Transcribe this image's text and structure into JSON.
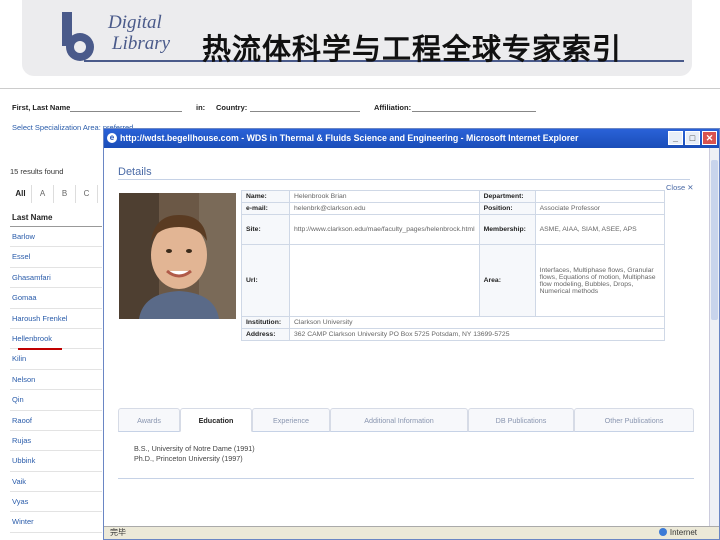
{
  "slide": {
    "logo_line1": "Digital",
    "logo_line2": "Library",
    "title": "热流体科学与工程全球专家索引"
  },
  "search_page": {
    "labels": {
      "name": "First, Last Name",
      "in": "in:",
      "country": "Country:",
      "affiliation": "Affiliation:"
    },
    "specialization": "Select Specialization Area:     preferred",
    "results_found": "15 results found",
    "alpha_tabs": [
      "All",
      "A",
      "B",
      "C"
    ],
    "list_header": "Last Name",
    "names": [
      "Barlow",
      "Essel",
      "Ghasamfari",
      "Gomaa",
      "Haroush Frenkel",
      "Hellenbrook",
      "Kilin",
      "Nelson",
      "Qin",
      "Raoof",
      "Rujas",
      "Ubbink",
      "Vaik",
      "Vyas",
      "Winter"
    ],
    "selected_name": "Hellenbrook"
  },
  "ie_window": {
    "title": "http://wdst.begellhouse.com - WDS in Thermal & Fluids Science and Engineering - Microsoft Internet Explorer",
    "status_left": "完毕",
    "status_right": "Internet"
  },
  "details": {
    "heading": "Details",
    "close": "Close ✕",
    "fields": {
      "name_label": "Name:",
      "name_value": "Helenbrook Brian",
      "department_label": "Department:",
      "department_value": "",
      "email_label": "e-mail:",
      "email_value": "helenbrk@clarkson.edu",
      "position_label": "Position:",
      "position_value": "Associate Professor",
      "site_label": "Site:",
      "site_value": "http://www.clarkson.edu/mae/faculty_pages/helenbrock.html",
      "membership_label": "Membership:",
      "membership_value": "ASME, AIAA, SIAM, ASEE, APS",
      "url_label": "Url:",
      "url_value": "",
      "area_label": "Area:",
      "area_value": "Interfaces, Multiphase flows, Granular flows, Equations of motion, Multiphase flow modeling, Bubbles, Drops, Numerical methods",
      "institution_label": "Institution:",
      "institution_value": "Clarkson University",
      "address_label": "Address:",
      "address_value": "362 CAMP Clarkson University PO Box 5725 Potsdam, NY 13699-5725"
    },
    "tabs": [
      "Awards",
      "Education",
      "Experience",
      "Additional Information",
      "DB Publications",
      "Other Publications"
    ],
    "active_tab": "Education",
    "education": [
      "B.S., University of Notre Dame (1991)",
      "Ph.D., Princeton University (1997)"
    ]
  },
  "colors": {
    "ie_title_bar": "#2a62d8",
    "link_blue": "#2a5caa",
    "highlight_underline": "#c00000",
    "logo_blue": "#4a5a8a"
  }
}
